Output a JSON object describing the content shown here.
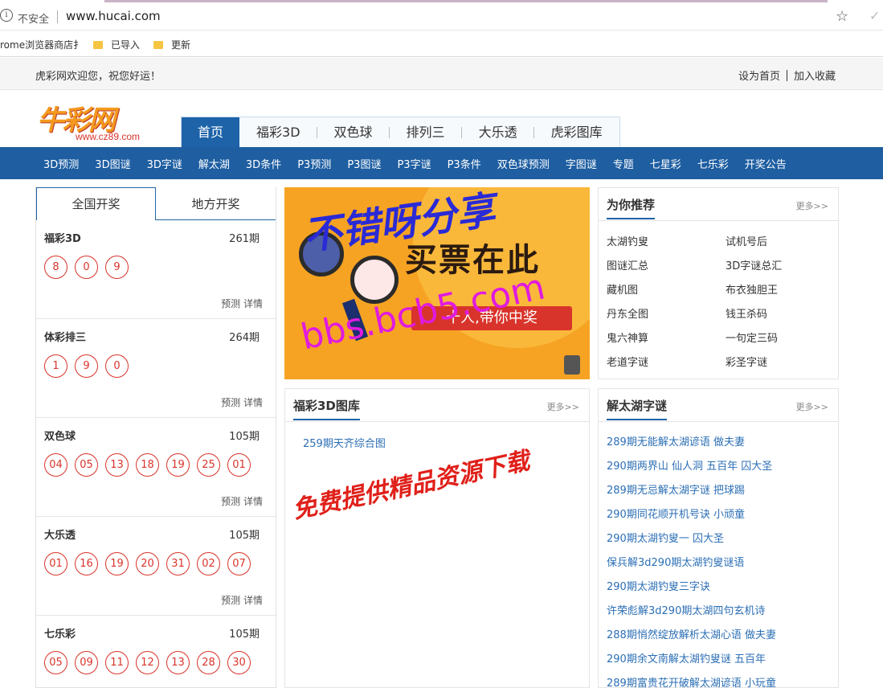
{
  "browser": {
    "security_label": "不安全",
    "url": "www.hucai.com",
    "bookmarks": [
      "rome浏览器商店扌",
      "已导入",
      "更新"
    ]
  },
  "welcome": {
    "text": "虎彩网欢迎您，祝您好运！",
    "set_home": "设为首页",
    "add_fav": "加入收藏"
  },
  "logo": {
    "text": "牛彩网",
    "domain": "www.cz89.com"
  },
  "main_tabs": [
    "首页",
    "福彩3D",
    "双色球",
    "排列三",
    "大乐透",
    "虎彩图库"
  ],
  "nav_items": [
    "3D预测",
    "3D图谜",
    "3D字谜",
    "解太湖",
    "3D条件",
    "P3预测",
    "P3图谜",
    "P3字谜",
    "P3条件",
    "双色球预测",
    "字图谜",
    "专题",
    "七星彩",
    "七乐彩",
    "开奖公告"
  ],
  "lottery_tabs": [
    "全国开奖",
    "地方开奖"
  ],
  "lotteries": [
    {
      "name": "福彩3D",
      "issue": "261期",
      "balls": [
        "8",
        "0",
        "9"
      ],
      "predict": "预测",
      "detail": "详情"
    },
    {
      "name": "体彩排三",
      "issue": "264期",
      "balls": [
        "1",
        "9",
        "0"
      ],
      "predict": "预测",
      "detail": "详情"
    },
    {
      "name": "双色球",
      "issue": "105期",
      "balls": [
        "04",
        "05",
        "13",
        "18",
        "19",
        "25",
        "01"
      ],
      "predict": "预测",
      "detail": "详情"
    },
    {
      "name": "大乐透",
      "issue": "105期",
      "balls": [
        "01",
        "16",
        "19",
        "20",
        "31",
        "02",
        "07"
      ],
      "predict": "预测",
      "detail": "详情"
    },
    {
      "name": "七乐彩",
      "issue": "105期",
      "balls": [
        "05",
        "09",
        "11",
        "12",
        "13",
        "28",
        "30"
      ],
      "predict": "预测",
      "detail": "详情"
    }
  ],
  "banner": {
    "title": "买票在此",
    "pill": "十人,带你中奖",
    "watermark_top": "不错呀分享",
    "watermark_url": "bbs.bcb5.com"
  },
  "recommend": {
    "title": "为你推荐",
    "more": "更多>>",
    "items": [
      "太湖钓叟",
      "试机号后",
      "图谜汇总",
      "3D字谜总汇",
      "藏机图",
      "布衣独胆王",
      "丹东全图",
      "钱王杀码",
      "鬼六神算",
      "一句定三码",
      "老道字谜",
      "彩圣字谜"
    ]
  },
  "tuku": {
    "title": "福彩3D图库",
    "more": "更多>>",
    "row": "259期天齐综合图",
    "watermark": "免费提供精品资源下载"
  },
  "taihu": {
    "title": "解太湖字谜",
    "more": "更多>>",
    "items": [
      "289期无能解太湖谚语 做夫妻",
      "290期两界山 仙人洞 五百年 囚大圣",
      "289期无忌解太湖字谜 把球踢",
      "290期同花顺开机号诀 小顽童",
      "290期太湖钓叟一 囚大圣",
      "保兵解3d290期太湖钓叟谜语",
      "290期太湖钓叟三字诀",
      "许荣彪解3d290期太湖四句玄机诗",
      "288期悄然绽放解析太湖心语 做夫妻",
      "290期余文南解太湖钓叟谜 五百年",
      "289期富贵花开破解太湖谚语 小玩童"
    ]
  },
  "colors": {
    "primary": "#1e63a8",
    "nav": "#1e5ea1",
    "ball": "#d9342b",
    "link": "#2c6fb5"
  }
}
